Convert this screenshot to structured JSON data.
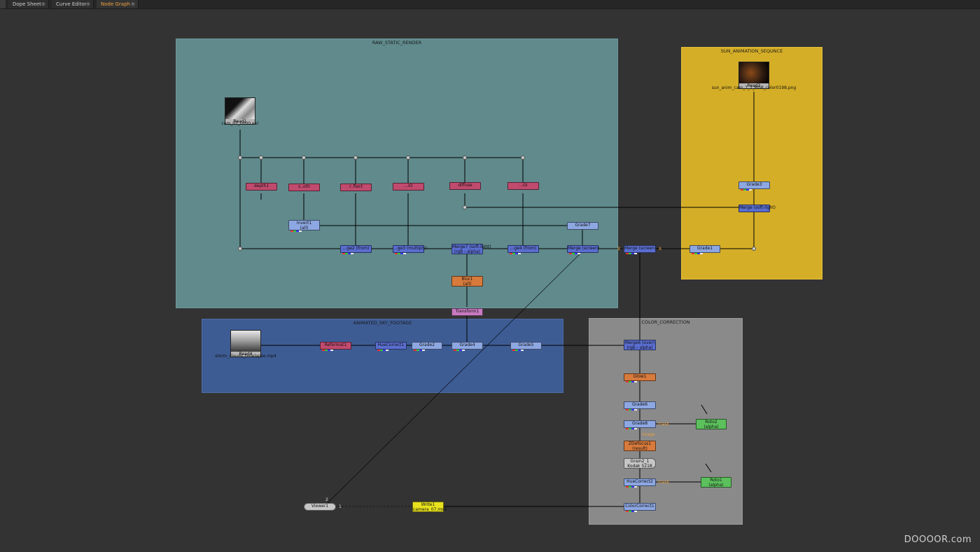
{
  "tabs": [
    {
      "label": "Dope Sheet"
    },
    {
      "label": "Curve Editor"
    },
    {
      "label": "Node Graph"
    }
  ],
  "backdrops": {
    "raw": "RAW_STATIC_RENDER",
    "sun": "SUN_ANIMATION_SEQUNCE",
    "sky": "ANIMATED_SKY_FOOTAGE",
    "cc": "COLOR_CORRECTION"
  },
  "reads": {
    "read1": {
      "name": "Read1",
      "file": "cam_07_0000.exr"
    },
    "read2": {
      "name": "Read2",
      "file": "sun_anim_cam_7_1_RGB_color0198.png"
    },
    "read4": {
      "name": "Read4",
      "file": "storm_clouds_timelapse.mp4"
    }
  },
  "nodes": {
    "depth1": "depth1",
    "shuffle_b": "s..oth",
    "shuffle_c": "r..flect",
    "shuffle_d": "...IO",
    "shuffle_e": "diffuse",
    "shuffle_f": "...GI",
    "invert1": "Invert1",
    "invert1_sub": "(all)",
    "grade7": "Grade7",
    "merge_from1": "...ge2 (from)",
    "merge_mult": "...ge3 (multiply)",
    "merge7": "Merge7 (soft-light)",
    "merge7_sub": "(rgb - alpha)",
    "merge_from2": "...ge4 (from)",
    "merge_screen1": "Merge (screen)",
    "merge_screen2": "Merge (screen)",
    "blur1": "Blur1",
    "blur1_sub": "(all)",
    "transform1": "Transform1",
    "grade3": "Grade3",
    "merge_soft": "Merge (soft-light)",
    "grade1": "Grade1",
    "reformat1": "Reformat1",
    "huecorrect1": "HueCorrect1",
    "grade2": "Grade2",
    "grade4": "Grade4",
    "grade5": "Grade5",
    "merge6": "Merge6 (over)",
    "merge6_sub": "(rgb - alpha)",
    "glow1": "Glow1",
    "grade6": "Grade6",
    "grade8": "Grade8",
    "zdefocus1": "ZDefocus1",
    "zdefocus1_sub": "(result)",
    "grain2": "Grain2_1",
    "grain2_sub": "Kodak 5218",
    "huecorrect2": "HueCorrect2",
    "colorcorrect1": "ColorCorrect1",
    "roto2": "Roto2",
    "roto2_sub": "(alpha)",
    "roto1": "Roto1",
    "roto1_sub": "(alpha)",
    "write1": "Write1",
    "write1_sub": "camera_07.mov",
    "viewer1": "Viewer1"
  },
  "labels": {
    "mask1": "mask",
    "mask2": "mask",
    "image": "image",
    "a": "A",
    "b": "B",
    "viewer_in": "2",
    "viewer_one": "1"
  },
  "watermark": "DOOOOR.com",
  "colors": {
    "raw_backdrop": "#608a8c",
    "sun_backdrop": "#d5ae27",
    "sky_backdrop": "#3e5c94",
    "cc_backdrop": "#8a8a8a"
  }
}
